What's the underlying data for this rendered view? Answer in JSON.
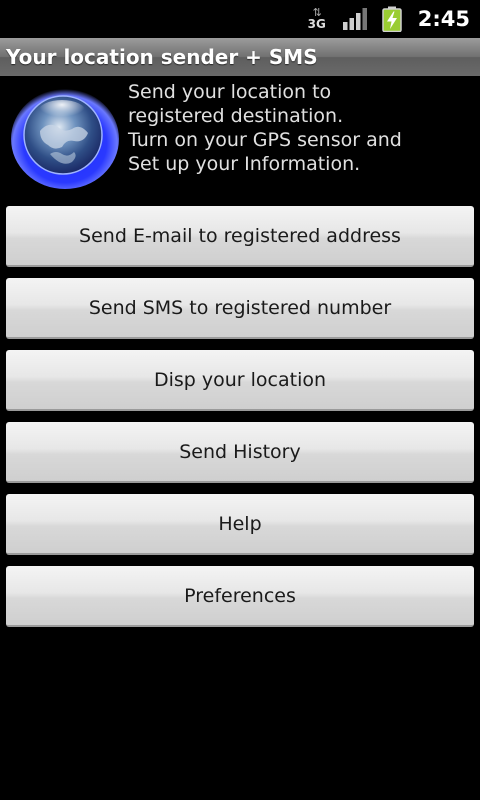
{
  "status_bar": {
    "network": "3G",
    "time": "2:45",
    "icons": [
      "data-transfer-icon",
      "signal-icon",
      "battery-charging-icon"
    ]
  },
  "app": {
    "title": "Your location sender + SMS"
  },
  "header": {
    "description_lines": [
      "Send your location to",
      "registered destination.",
      "Turn on your GPS sensor and",
      "Set up your Information."
    ],
    "icon": "globe-icon"
  },
  "buttons": [
    {
      "label": "Send E-mail to registered address"
    },
    {
      "label": "Send SMS to registered number"
    },
    {
      "label": "Disp your location"
    },
    {
      "label": "Send History"
    },
    {
      "label": "Help"
    },
    {
      "label": "Preferences"
    }
  ],
  "colors": {
    "background": "#000000",
    "title_bar": "#707070",
    "button_face": "#e0e0e0",
    "battery_accent": "#9acd32",
    "globe_glow": "#3a4dff"
  }
}
